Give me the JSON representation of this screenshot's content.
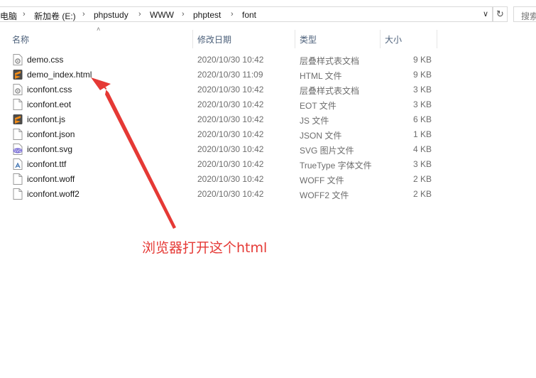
{
  "breadcrumb": {
    "items": [
      "电脑",
      "新加卷 (E:)",
      "phpstudy",
      "WWW",
      "phptest",
      "font"
    ]
  },
  "search": {
    "placeholder": "搜索"
  },
  "columns": {
    "name": "名称",
    "date": "修改日期",
    "type": "类型",
    "size": "大小"
  },
  "files": [
    {
      "name": "demo.css",
      "date": "2020/10/30 10:42",
      "type": "层叠样式表文档",
      "size": "9 KB",
      "icon": "css-file-icon"
    },
    {
      "name": "demo_index.html",
      "date": "2020/10/30 11:09",
      "type": "HTML 文件",
      "size": "9 KB",
      "icon": "sublime-file-icon"
    },
    {
      "name": "iconfont.css",
      "date": "2020/10/30 10:42",
      "type": "层叠样式表文档",
      "size": "3 KB",
      "icon": "css-file-icon"
    },
    {
      "name": "iconfont.eot",
      "date": "2020/10/30 10:42",
      "type": "EOT 文件",
      "size": "3 KB",
      "icon": "blank-file-icon"
    },
    {
      "name": "iconfont.js",
      "date": "2020/10/30 10:42",
      "type": "JS 文件",
      "size": "6 KB",
      "icon": "sublime-file-icon"
    },
    {
      "name": "iconfont.json",
      "date": "2020/10/30 10:42",
      "type": "JSON 文件",
      "size": "1 KB",
      "icon": "blank-file-icon"
    },
    {
      "name": "iconfont.svg",
      "date": "2020/10/30 10:42",
      "type": "SVG 图片文件",
      "size": "4 KB",
      "icon": "svg-file-icon"
    },
    {
      "name": "iconfont.ttf",
      "date": "2020/10/30 10:42",
      "type": "TrueType 字体文件",
      "size": "3 KB",
      "icon": "font-file-icon"
    },
    {
      "name": "iconfont.woff",
      "date": "2020/10/30 10:42",
      "type": "WOFF 文件",
      "size": "2 KB",
      "icon": "blank-file-icon"
    },
    {
      "name": "iconfont.woff2",
      "date": "2020/10/30 10:42",
      "type": "WOFF2 文件",
      "size": "2 KB",
      "icon": "blank-file-icon"
    }
  ],
  "annotation": {
    "text": "浏览器打开这个html",
    "color": "#e53935"
  },
  "colors": {
    "header_text": "#4c607a",
    "secondary_text": "#6d6d6d",
    "sublime_orange": "#f28c18"
  }
}
